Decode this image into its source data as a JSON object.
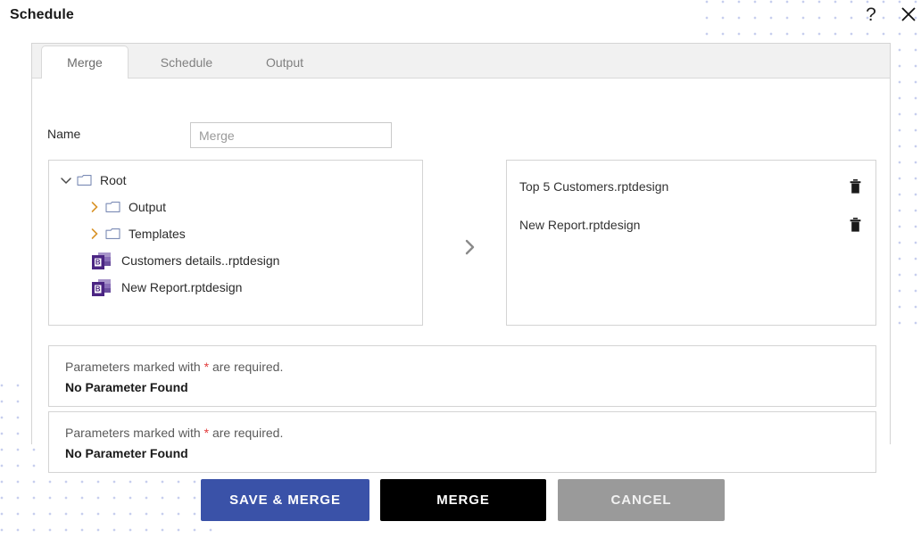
{
  "header": {
    "title": "Schedule",
    "help_icon": "question-mark-icon",
    "close_icon": "close-icon"
  },
  "tabs": [
    {
      "id": "merge",
      "label": "Merge",
      "active": true
    },
    {
      "id": "schedule",
      "label": "Schedule",
      "active": false
    },
    {
      "id": "output",
      "label": "Output",
      "active": false
    }
  ],
  "form": {
    "name_label": "Name",
    "name_value": "Merge",
    "name_placeholder": "Merge"
  },
  "tree": {
    "root": {
      "label": "Root",
      "expanded": true,
      "icon": "folder-icon"
    },
    "children": [
      {
        "label": "Output",
        "type": "folder",
        "expanded": false,
        "icon": "folder-icon"
      },
      {
        "label": "Templates",
        "type": "folder",
        "expanded": false,
        "icon": "folder-icon"
      },
      {
        "label": "Customers details..rptdesign",
        "type": "report",
        "icon": "birt-report-icon"
      },
      {
        "label": "New Report.rptdesign",
        "type": "report",
        "icon": "birt-report-icon"
      }
    ]
  },
  "transfer": {
    "icon": "chevron-right-icon"
  },
  "selected": {
    "items": [
      {
        "name": "Top 5 Customers.rptdesign",
        "delete_icon": "trash-icon"
      },
      {
        "name": "New Report.rptdesign",
        "delete_icon": "trash-icon"
      }
    ]
  },
  "parameters": [
    {
      "hint_before": "Parameters marked with ",
      "hint_star": "*",
      "hint_after": " are required.",
      "status": "No Parameter Found"
    },
    {
      "hint_before": "Parameters marked with ",
      "hint_star": "*",
      "hint_after": " are required.",
      "status": "No Parameter Found"
    }
  ],
  "footer": {
    "save_merge_label": "SAVE & MERGE",
    "merge_label": "MERGE",
    "cancel_label": "CANCEL"
  },
  "colors": {
    "primary_blue": "#3a52a8",
    "merge_black": "#000000",
    "cancel_gray": "#9a9a9a",
    "required_star_red": "#e23b3b",
    "dot_pattern": "#9aa6e0",
    "caret_orange": "#d9942a",
    "folder_outline": "#7b8bb5"
  }
}
